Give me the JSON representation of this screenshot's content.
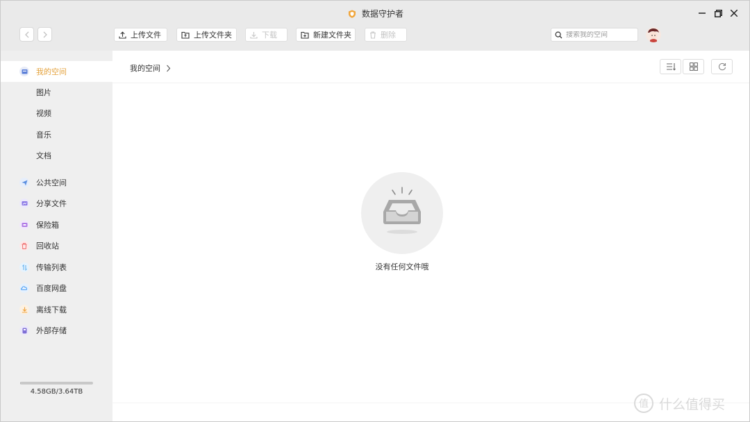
{
  "window": {
    "title": "数据守护者",
    "accent_color": "#e8a33a"
  },
  "toolbar": {
    "buttons": [
      {
        "label": "上传文件",
        "icon": "upload-icon",
        "enabled": true
      },
      {
        "label": "上传文件夹",
        "icon": "upload-folder-icon",
        "enabled": true
      },
      {
        "label": "下载",
        "icon": "download-icon",
        "enabled": false
      },
      {
        "label": "新建文件夹",
        "icon": "new-folder-icon",
        "enabled": true
      },
      {
        "label": "删除",
        "icon": "trash-icon",
        "enabled": false
      }
    ],
    "search_placeholder": "搜索我的空间"
  },
  "sidebar": {
    "items": [
      {
        "label": "我的空间",
        "icon": "my-space-icon",
        "active": true
      },
      {
        "label": "图片"
      },
      {
        "label": "视频"
      },
      {
        "label": "音乐"
      },
      {
        "label": "文档"
      },
      {
        "label": "公共空间",
        "icon": "public-space-icon",
        "color": "#5b8fe0"
      },
      {
        "label": "分享文件",
        "icon": "share-files-icon",
        "color": "#7e6fe0"
      },
      {
        "label": "保险箱",
        "icon": "safe-box-icon",
        "color": "#a56fe0"
      },
      {
        "label": "回收站",
        "icon": "recycle-bin-icon",
        "color": "#ef6b6b"
      },
      {
        "label": "传输列表",
        "icon": "transfer-list-icon",
        "color": "#5aaef0"
      },
      {
        "label": "百度网盘",
        "icon": "baidu-netdisk-icon",
        "color": "#4a9ef5"
      },
      {
        "label": "离线下载",
        "icon": "offline-download-icon",
        "color": "#f0a23c"
      },
      {
        "label": "外部存储",
        "icon": "external-storage-icon",
        "color": "#7f6fd6"
      }
    ],
    "storage": {
      "text": "4.58GB/3.64TB",
      "used_fraction": 0.0012
    }
  },
  "main": {
    "breadcrumb": "我的空间",
    "empty_message": "没有任何文件哦"
  },
  "watermark": {
    "text": "什么值得买",
    "logo_char": "值"
  }
}
